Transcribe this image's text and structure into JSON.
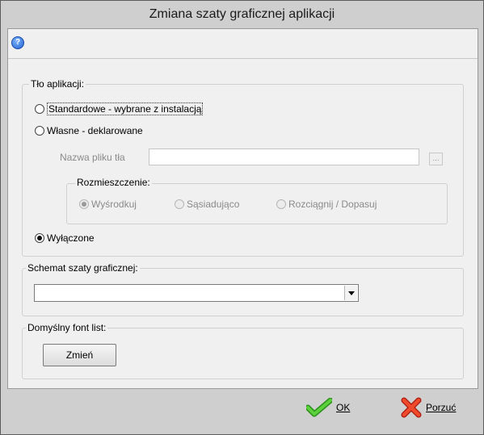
{
  "window": {
    "title": "Zmiana szaty graficznej aplikacji"
  },
  "toolbar": {
    "help_icon": "help-icon",
    "help_glyph": "?"
  },
  "background_group": {
    "legend": "Tło aplikacji:",
    "option_standard": "Standardowe - wybrane z instalacją",
    "option_custom": "Własne - deklarowane",
    "filename_label": "Nazwa pliku tła",
    "filename_value": "",
    "browse_label": "...",
    "placement": {
      "legend": "Rozmieszczenie:",
      "center": "Wyśrodkuj",
      "tile": "Sąsiadująco",
      "stretch": "Rozciągnij / Dopasuj"
    },
    "option_off": "Wyłączone",
    "selected": "option_off"
  },
  "scheme_group": {
    "legend": "Schemat szaty graficznej:",
    "selected_value": ""
  },
  "font_group": {
    "legend": "Domyślny font list:",
    "change_button": "Zmień"
  },
  "footer": {
    "ok_label": "OK",
    "ok_icon": "checkmark-icon",
    "cancel_label": "Porzuć",
    "cancel_icon": "x-cross-icon",
    "ok_color": "#3fae2a",
    "cancel_color": "#e23a1f"
  }
}
